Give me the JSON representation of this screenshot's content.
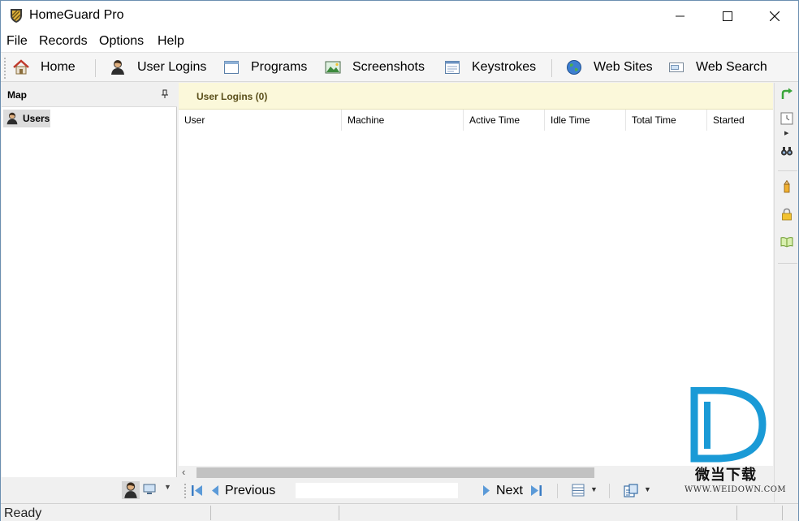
{
  "window": {
    "title": "HomeGuard Pro",
    "controls": {
      "minimize": "—",
      "maximize": "☐",
      "close": "✕"
    }
  },
  "menu": [
    "File",
    "Records",
    "Options",
    "Help"
  ],
  "toolbar": {
    "items": [
      {
        "label": "Home",
        "icon": "home-icon"
      },
      {
        "label": "User Logins",
        "icon": "user-icon"
      },
      {
        "label": "Programs",
        "icon": "window-icon"
      },
      {
        "label": "Screenshots",
        "icon": "image-icon"
      },
      {
        "label": "Keystrokes",
        "icon": "keyboard-icon"
      },
      {
        "label": "Web Sites",
        "icon": "globe-icon"
      },
      {
        "label": "Web Search",
        "icon": "searchbox-icon"
      }
    ]
  },
  "left_pane": {
    "title": "Map",
    "tree": [
      {
        "label": "Users",
        "icon": "user-icon",
        "selected": true
      }
    ]
  },
  "main": {
    "header": "User Logins (0)",
    "columns": [
      "User",
      "Machine",
      "Active Time",
      "Idle Time",
      "Total Time",
      "Started"
    ],
    "rows": []
  },
  "navigation": {
    "previous": "Previous",
    "next": "Next"
  },
  "right_sidebar": {
    "icons": [
      "refresh-icon",
      "clock-icon",
      "binoculars-icon",
      "pen-icon",
      "lock-icon",
      "book-icon"
    ]
  },
  "status": {
    "text": "Ready"
  },
  "watermark": {
    "brand": "微当下载",
    "url": "WWW.WEIDOWN.COM"
  },
  "colors": {
    "header_bg": "#fbf8da",
    "accent_blue": "#1a9ad6"
  }
}
